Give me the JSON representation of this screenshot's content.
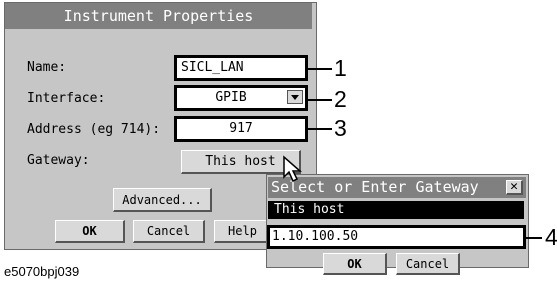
{
  "dialog": {
    "title": "Instrument Properties",
    "name_label": "Name:",
    "name_value": "SICL_LAN",
    "interface_label": "Interface:",
    "interface_value": "GPIB",
    "address_label": "Address (eg 714):",
    "address_value": "917",
    "gateway_label": "Gateway:",
    "gateway_value": "This host",
    "advanced_button": "Advanced...",
    "ok_button": "OK",
    "cancel_button": "Cancel",
    "help_button": "Help"
  },
  "popup": {
    "title": "Select or Enter Gateway",
    "list_item": "This host",
    "input_value": "1.10.100.50",
    "ok_button": "OK",
    "cancel_button": "Cancel"
  },
  "callouts": [
    "1",
    "2",
    "3",
    "4"
  ],
  "caption": "e5070bpj039",
  "colors": {
    "dialog_bg": "#c6c6c6",
    "titlebar": "#808080",
    "selected_item": "#000000"
  },
  "icons": {
    "dropdown": "triangle-down",
    "close": "x-mark",
    "cursor": "arrow-pointer"
  }
}
